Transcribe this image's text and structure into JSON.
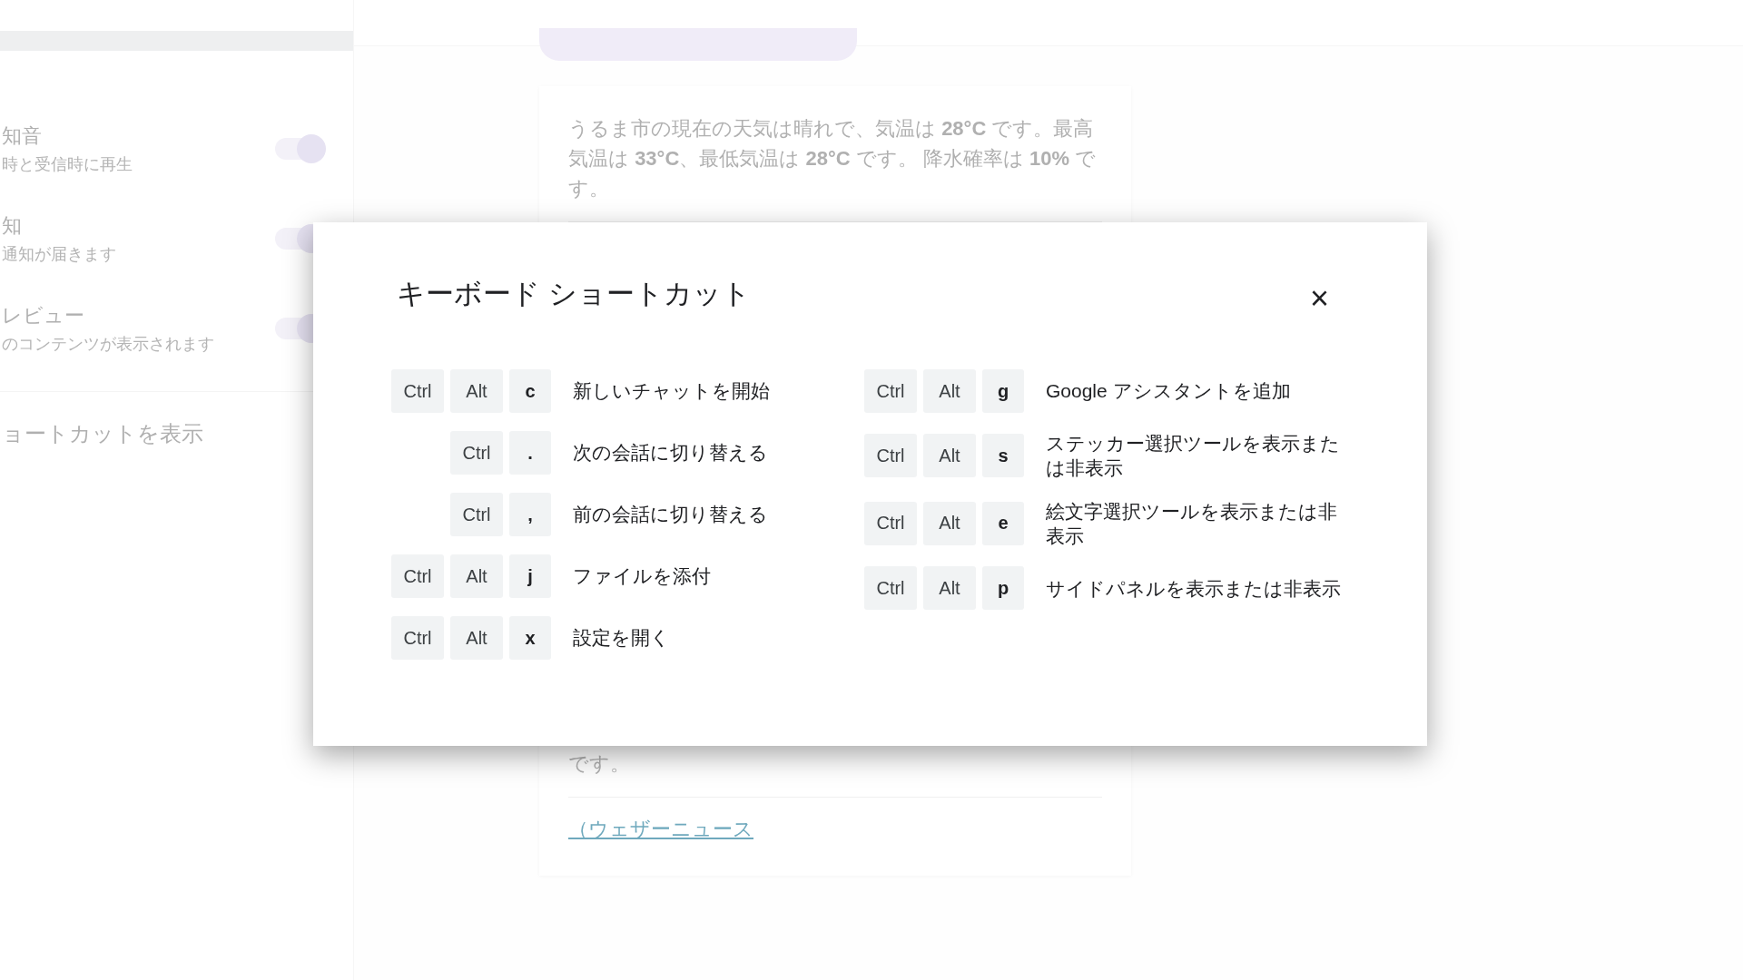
{
  "settings": {
    "items": [
      {
        "title": "知音",
        "subtitle": "時と受信時に再生",
        "on": true
      },
      {
        "title": "知",
        "subtitle": "通知が届きます",
        "on": true
      },
      {
        "title": "レビュー",
        "subtitle": "のコンテンツが表示されます",
        "on": true
      }
    ],
    "shortcuts_link": "ョートカットを表示"
  },
  "chat": {
    "answer": "うるま市の現在の天気は晴れで、気温は **28°C** です。最高気温は **33°C**、最低気温は **28°C** です。 降水確率は **10%** です。",
    "answer_tail": "です。",
    "source_link": "（ウェザーニュース"
  },
  "dialog": {
    "title": "キーボード ショートカット",
    "close": "×",
    "left": [
      {
        "keys": [
          "Ctrl",
          "Alt",
          "c"
        ],
        "label": "新しいチャットを開始"
      },
      {
        "keys": [
          "Ctrl",
          "."
        ],
        "label": "次の会話に切り替える"
      },
      {
        "keys": [
          "Ctrl",
          ","
        ],
        "label": "前の会話に切り替える"
      },
      {
        "keys": [
          "Ctrl",
          "Alt",
          "j"
        ],
        "label": "ファイルを添付"
      },
      {
        "keys": [
          "Ctrl",
          "Alt",
          "x"
        ],
        "label": "設定を開く"
      }
    ],
    "right": [
      {
        "keys": [
          "Ctrl",
          "Alt",
          "g"
        ],
        "label": "Google アシスタントを追加"
      },
      {
        "keys": [
          "Ctrl",
          "Alt",
          "s"
        ],
        "label": "ステッカー選択ツールを表示または非表示"
      },
      {
        "keys": [
          "Ctrl",
          "Alt",
          "e"
        ],
        "label": "絵文字選択ツールを表示または非表示"
      },
      {
        "keys": [
          "Ctrl",
          "Alt",
          "p"
        ],
        "label": "サイドパネルを表示または非表示"
      }
    ]
  }
}
